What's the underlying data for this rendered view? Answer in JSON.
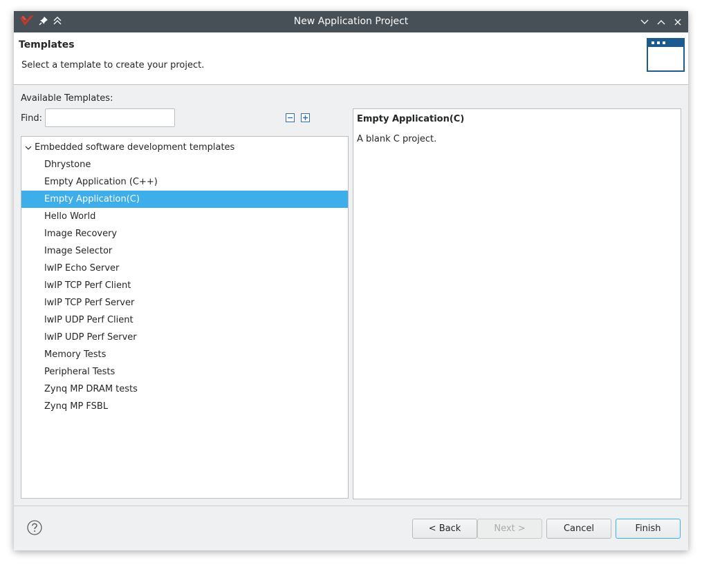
{
  "window": {
    "title": "New Application Project"
  },
  "header": {
    "title": "Templates",
    "subtitle": "Select a template to create your project."
  },
  "templates": {
    "available_label": "Available Templates:",
    "find_label": "Find:",
    "find_value": "",
    "group_label": "Embedded software development templates",
    "items": [
      "Dhrystone",
      "Empty Application (C++)",
      "Empty Application(C)",
      "Hello World",
      "Image Recovery",
      "Image Selector",
      "lwIP Echo Server",
      "lwIP TCP Perf Client",
      "lwIP TCP Perf Server",
      "lwIP UDP Perf Client",
      "lwIP UDP Perf Server",
      "Memory Tests",
      "Peripheral Tests",
      "Zynq MP DRAM tests",
      "Zynq MP FSBL"
    ],
    "selected_item": "Empty Application(C)"
  },
  "description": {
    "title": "Empty Application(C)",
    "text": "A blank C project."
  },
  "buttons": {
    "back": "< Back",
    "next": "Next >",
    "cancel": "Cancel",
    "finish": "Finish"
  },
  "colors": {
    "titlebar": "#475057",
    "selection": "#3daee9",
    "accent": "#3daee9"
  }
}
